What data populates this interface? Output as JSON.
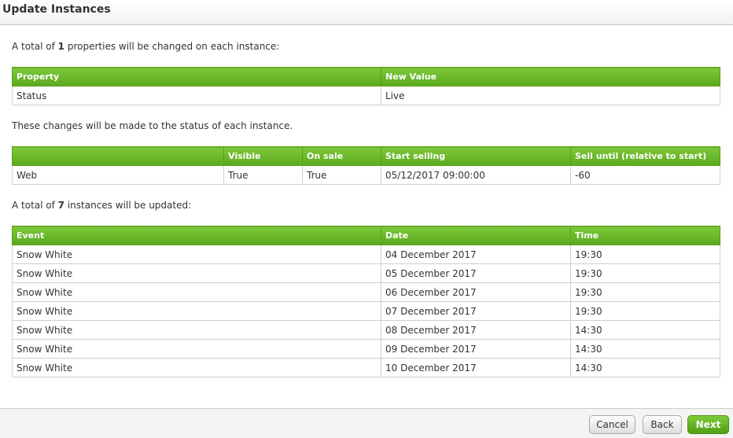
{
  "dialog": {
    "title": "Update Instances"
  },
  "properties_intro": {
    "prefix": "A total of ",
    "count": "1",
    "suffix": " properties will be changed on each instance:"
  },
  "properties_table": {
    "headers": [
      "Property",
      "New Value"
    ],
    "rows": [
      [
        "Status",
        "Live"
      ]
    ]
  },
  "status_intro": "These changes will be made to the status of each instance.",
  "status_table": {
    "headers": [
      "",
      "Visible",
      "On sale",
      "Start selling",
      "Sell until (relative to start)"
    ],
    "rows": [
      [
        "Web",
        "True",
        "True",
        "05/12/2017 09:00:00",
        "-60"
      ]
    ]
  },
  "instances_intro": {
    "prefix": "A total of ",
    "count": "7",
    "suffix": " instances will be updated:"
  },
  "instances_table": {
    "headers": [
      "Event",
      "Date",
      "Time"
    ],
    "rows": [
      [
        "Snow White",
        "04 December 2017",
        "19:30"
      ],
      [
        "Snow White",
        "05 December 2017",
        "19:30"
      ],
      [
        "Snow White",
        "06 December 2017",
        "19:30"
      ],
      [
        "Snow White",
        "07 December 2017",
        "19:30"
      ],
      [
        "Snow White",
        "08 December 2017",
        "14:30"
      ],
      [
        "Snow White",
        "09 December 2017",
        "14:30"
      ],
      [
        "Snow White",
        "10 December 2017",
        "14:30"
      ]
    ]
  },
  "footer": {
    "cancel_label": "Cancel",
    "back_label": "Back",
    "next_label": "Next"
  },
  "colors": {
    "header_green": "#6ab82b",
    "primary_button": "#5aa91f"
  }
}
